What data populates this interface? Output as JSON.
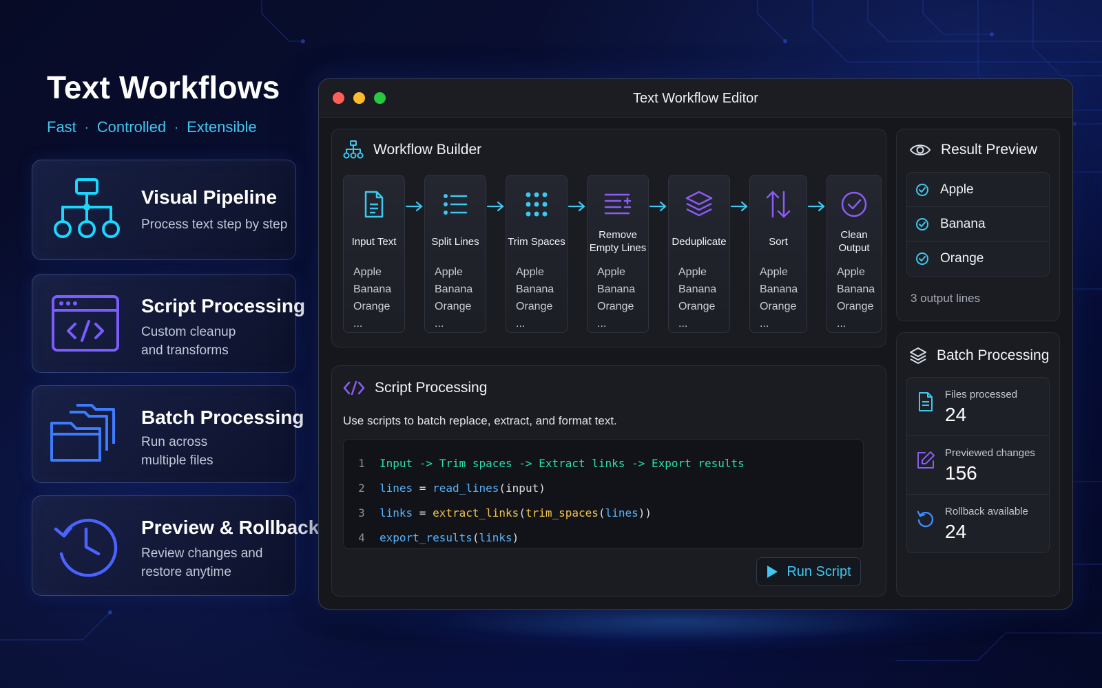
{
  "hero": {
    "title": "Text Workflows",
    "tags": [
      "Fast",
      "Controlled",
      "Extensible"
    ],
    "separator": "·"
  },
  "features": [
    {
      "title": "Visual Pipeline",
      "desc": "Process text step by step",
      "icon": "hierarchy-icon"
    },
    {
      "title": "Script Processing",
      "desc": "Custom cleanup and transforms",
      "icon": "code-window-icon"
    },
    {
      "title": "Batch Processing",
      "desc": "Run across multiple files",
      "icon": "stacked-folders-icon"
    },
    {
      "title": "Preview & Rollback",
      "desc": "Review changes and restore anytime",
      "icon": "history-clock-icon"
    }
  ],
  "window": {
    "title": "Text Workflow Editor"
  },
  "workflow": {
    "title": "Workflow Builder",
    "steps": [
      {
        "label": "Input Text",
        "items": [
          "Apple",
          "Banana",
          "Orange",
          "..."
        ],
        "icon": "document-icon"
      },
      {
        "label": "Split Lines",
        "items": [
          "Apple",
          "Banana",
          "Orange",
          "..."
        ],
        "icon": "list-icon"
      },
      {
        "label": "Trim Spaces",
        "items": [
          "Apple",
          "Banana",
          "Orange",
          "..."
        ],
        "icon": "dots-grid-icon"
      },
      {
        "label": "Remove Empty Lines",
        "items": [
          "Apple",
          "Banana",
          "Orange",
          "..."
        ],
        "icon": "remove-lines-icon"
      },
      {
        "label": "Deduplicate",
        "items": [
          "Apple",
          "Banana",
          "Orange",
          "..."
        ],
        "icon": "layers-icon"
      },
      {
        "label": "Sort",
        "items": [
          "Apple",
          "Banana",
          "Orange",
          "..."
        ],
        "icon": "sort-arrows-icon"
      },
      {
        "label": "Clean Output",
        "items": [
          "Apple",
          "Banana",
          "Orange",
          "..."
        ],
        "icon": "check-circle-icon"
      }
    ]
  },
  "script": {
    "title": "Script Processing",
    "description": "Use scripts to batch replace, extract, and format text.",
    "lines": [
      {
        "n": "1",
        "tokens": [
          {
            "t": "Input -> Trim spaces -> Extract links -> Export results",
            "c": "green"
          }
        ]
      },
      {
        "n": "2",
        "tokens": [
          {
            "t": "lines",
            "c": "blue"
          },
          {
            "t": " = ",
            "c": "white"
          },
          {
            "t": "read_lines",
            "c": "blue"
          },
          {
            "t": "(input)",
            "c": "white"
          }
        ]
      },
      {
        "n": "3",
        "tokens": [
          {
            "t": "links",
            "c": "blue"
          },
          {
            "t": " = ",
            "c": "white"
          },
          {
            "t": "extract_links",
            "c": "yellow"
          },
          {
            "t": "(",
            "c": "white"
          },
          {
            "t": "trim_spaces",
            "c": "yellow"
          },
          {
            "t": "(",
            "c": "white"
          },
          {
            "t": "lines",
            "c": "blue"
          },
          {
            "t": "))",
            "c": "white"
          }
        ]
      },
      {
        "n": "4",
        "tokens": [
          {
            "t": "export_results",
            "c": "blue"
          },
          {
            "t": "(",
            "c": "white"
          },
          {
            "t": "links",
            "c": "blue"
          },
          {
            "t": ")",
            "c": "white"
          }
        ]
      }
    ],
    "run_label": "Run Script"
  },
  "result": {
    "title": "Result Preview",
    "items": [
      "Apple",
      "Banana",
      "Orange"
    ],
    "count_label": "3 output lines"
  },
  "batch": {
    "title": "Batch Processing",
    "stats": [
      {
        "label": "Files processed",
        "value": "24",
        "icon": "file-icon"
      },
      {
        "label": "Previewed changes",
        "value": "156",
        "icon": "edit-icon"
      },
      {
        "label": "Rollback available",
        "value": "24",
        "icon": "undo-icon"
      }
    ]
  },
  "colors": {
    "accent_cyan": "#3ec8f0",
    "accent_purple": "#8b5cf6",
    "code_green": "#28e0b0",
    "code_blue": "#57b4ff",
    "code_yellow": "#f3c44a"
  }
}
